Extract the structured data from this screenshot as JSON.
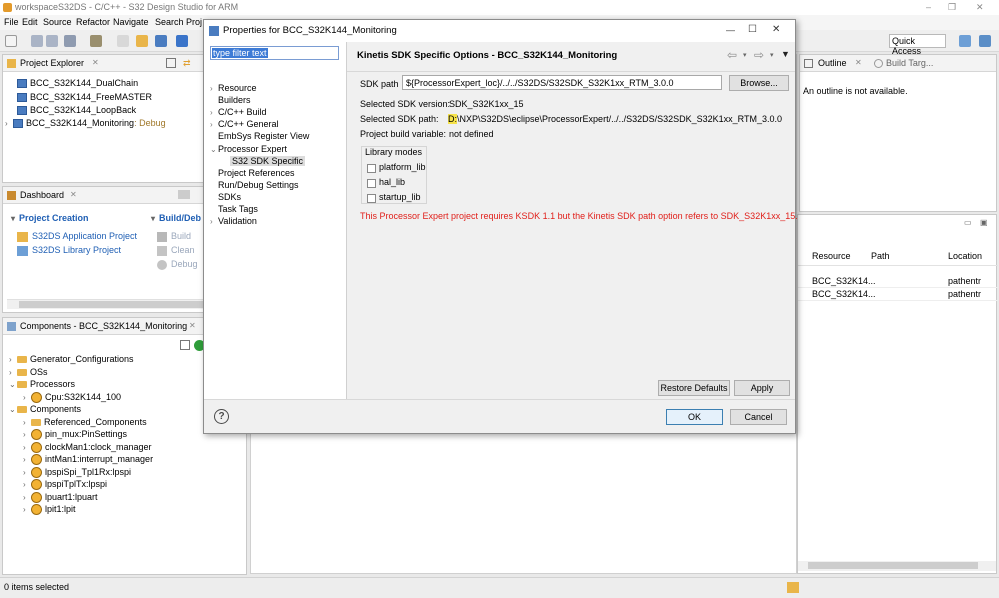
{
  "window": {
    "title": "workspaceS32DS - C/C++ - S32 Design Studio for ARM"
  },
  "menu": [
    "File",
    "Edit",
    "Source",
    "Refactor",
    "Navigate",
    "Search",
    "Proj"
  ],
  "quick_access": "Quick Access",
  "project_explorer": {
    "title": "Project Explorer",
    "items": [
      {
        "label": "BCC_S32K144_DualChain",
        "suffix": ""
      },
      {
        "label": "BCC_S32K144_FreeMASTER",
        "suffix": ""
      },
      {
        "label": "BCC_S32K144_LoopBack",
        "suffix": ""
      },
      {
        "label": "BCC_S32K144_Monitoring",
        "suffix": ": Debug"
      }
    ]
  },
  "dashboard": {
    "title": "Dashboard",
    "project_creation": "Project Creation",
    "build_debug": "Build/Deb",
    "links": [
      "S32DS Application Project",
      "S32DS Library Project"
    ],
    "build_links": [
      "Build",
      "Clean",
      "Debug"
    ],
    "build_suffix": [
      "(",
      "("
    ]
  },
  "components": {
    "title": "Components - BCC_S32K144_Monitoring",
    "items": [
      {
        "label": "Generator_Configurations",
        "indent": 0,
        "kind": "folder",
        "tw": "›"
      },
      {
        "label": "OSs",
        "indent": 0,
        "kind": "folder",
        "tw": "›"
      },
      {
        "label": "Processors",
        "indent": 0,
        "kind": "folder",
        "tw": "⌄"
      },
      {
        "label": "Cpu:S32K144_100",
        "indent": 1,
        "kind": "comp",
        "tw": "›"
      },
      {
        "label": "Components",
        "indent": 0,
        "kind": "folder",
        "tw": "⌄"
      },
      {
        "label": "Referenced_Components",
        "indent": 1,
        "kind": "folder",
        "tw": "›"
      },
      {
        "label": "pin_mux:PinSettings",
        "indent": 1,
        "kind": "comp",
        "tw": "›"
      },
      {
        "label": "clockMan1:clock_manager",
        "indent": 1,
        "kind": "comp",
        "tw": "›"
      },
      {
        "label": "intMan1:interrupt_manager",
        "indent": 1,
        "kind": "comp",
        "tw": "›"
      },
      {
        "label": "lpspiSpi_Tpl1Rx:lpspi",
        "indent": 1,
        "kind": "comp",
        "tw": "›"
      },
      {
        "label": "lpspiTplTx:lpspi",
        "indent": 1,
        "kind": "comp",
        "tw": "›"
      },
      {
        "label": "lpuart1:lpuart",
        "indent": 1,
        "kind": "comp",
        "tw": "›"
      },
      {
        "label": "lpit1:lpit",
        "indent": 1,
        "kind": "comp",
        "tw": "›"
      }
    ]
  },
  "outline": {
    "tab": "Outline",
    "tab2": "Build Targ...",
    "message": "An outline is not available."
  },
  "problems": {
    "headers": [
      "Resource",
      "Path",
      "Location"
    ],
    "rows": [
      [
        "BCC_S32K14...",
        "",
        "pathentr"
      ],
      [
        "BCC_S32K14...",
        "",
        "pathentr"
      ]
    ]
  },
  "status": {
    "text": "0 items selected"
  },
  "dialog": {
    "title": "Properties for BCC_S32K144_Monitoring",
    "filter": "type filter text",
    "nav": [
      {
        "label": "Resource",
        "tw": "›",
        "indent": 0
      },
      {
        "label": "Builders",
        "tw": "",
        "indent": 0
      },
      {
        "label": "C/C++ Build",
        "tw": "›",
        "indent": 0
      },
      {
        "label": "C/C++ General",
        "tw": "›",
        "indent": 0
      },
      {
        "label": "EmbSys Register View",
        "tw": "",
        "indent": 0
      },
      {
        "label": "Processor Expert",
        "tw": "⌄",
        "indent": 0
      },
      {
        "label": "S32 SDK Specific",
        "tw": "",
        "indent": 1
      },
      {
        "label": "Project References",
        "tw": "",
        "indent": 0
      },
      {
        "label": "Run/Debug Settings",
        "tw": "",
        "indent": 0
      },
      {
        "label": "SDKs",
        "tw": "",
        "indent": 0
      },
      {
        "label": "Task Tags",
        "tw": "",
        "indent": 0
      },
      {
        "label": "Validation",
        "tw": "›",
        "indent": 0
      }
    ],
    "page_title": "Kinetis SDK Specific Options - BCC_S32K144_Monitoring",
    "sdk_path_label": "SDK path",
    "sdk_path_value": "${ProcessorExpert_loc}/../../S32DS/S32SDK_S32K1xx_RTM_3.0.0",
    "browse": "Browse...",
    "selected_version_label": "Selected SDK version:",
    "selected_version_value": "SDK_S32K1xx_15",
    "selected_path_label": "Selected SDK path:",
    "selected_path_drive": "D:",
    "selected_path_value": "\\NXP\\S32DS\\eclipse\\ProcessorExpert/../../S32DS/S32SDK_S32K1xx_RTM_3.0.0",
    "build_var_label": "Project build variable:",
    "build_var_value": "not defined",
    "library_modes_label": "Library modes",
    "library_modes": [
      "platform_lib",
      "hal_lib",
      "startup_lib"
    ],
    "error": "This Processor Expert project requires KSDK 1.1 but the Kinetis SDK path option refers to SDK_S32K1xx_15.",
    "restore_defaults": "Restore Defaults",
    "apply": "Apply",
    "ok": "OK",
    "cancel": "Cancel",
    "help_icon": "?"
  },
  "colors": {
    "error": "#e0201b",
    "link": "#1f5fb4",
    "selection": "#3d7bd6"
  }
}
